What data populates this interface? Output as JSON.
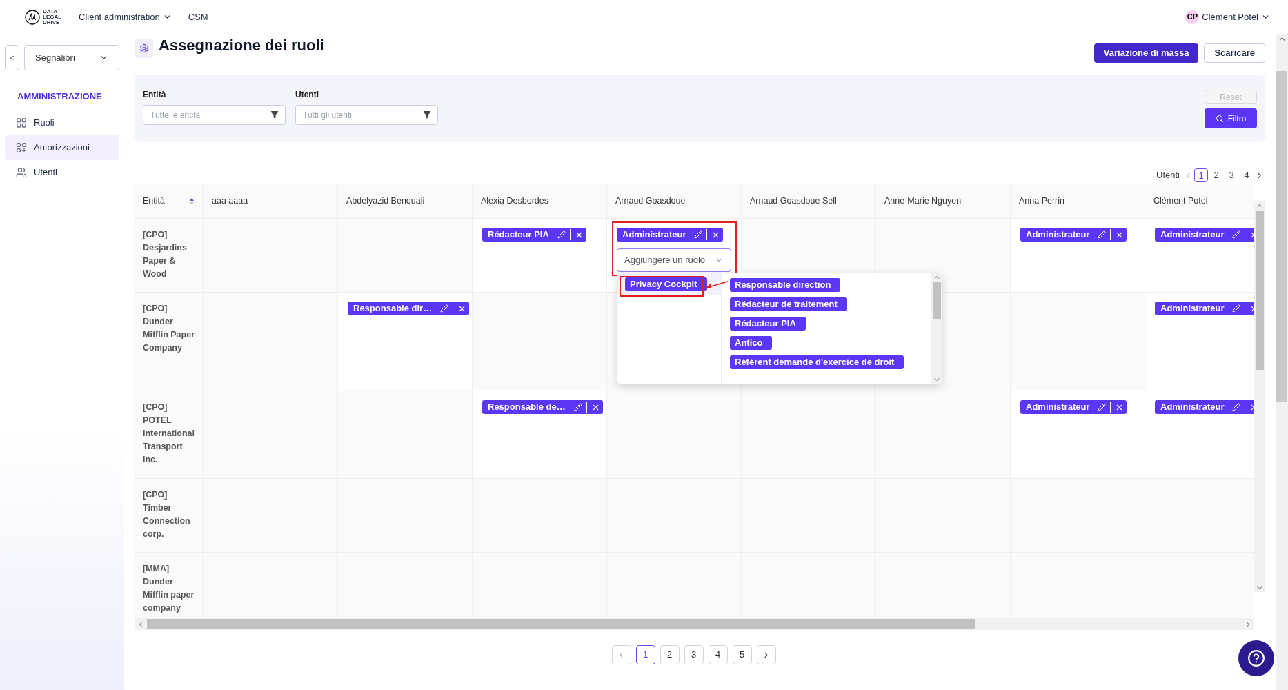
{
  "topbar": {
    "logo": "DATA LEGAL DRIVE",
    "nav": [
      {
        "label": "Client administration",
        "dropdown": true
      },
      {
        "label": "CSM",
        "dropdown": false
      }
    ],
    "user": {
      "initials": "CP",
      "name": "Clément Potel"
    }
  },
  "sidebar": {
    "back": "<",
    "bookmarks": "Segnalibri",
    "section": "AMMINISTRAZIONE",
    "items": [
      {
        "label": "Ruoli",
        "selected": false
      },
      {
        "label": "Autorizzazioni",
        "selected": true
      },
      {
        "label": "Utenti",
        "selected": false
      }
    ]
  },
  "page": {
    "title": "Assegnazione dei ruoli",
    "buttons": [
      {
        "label": "Variazione di massa",
        "kind": "primary"
      },
      {
        "label": "Scaricare",
        "kind": "outline"
      }
    ]
  },
  "filters": {
    "fields": [
      {
        "label": "Entità",
        "placeholder": "Tutte le entità"
      },
      {
        "label": "Utenti",
        "placeholder": "Tutti gli utenti"
      }
    ],
    "reset": {
      "label": "Reset",
      "disabled": true
    },
    "filter": {
      "label": "Filtro"
    }
  },
  "top_pagination": {
    "label": "Utenti",
    "pages": [
      {
        "label": "1",
        "selected": true
      },
      {
        "label": "2",
        "selected": false
      },
      {
        "label": "3",
        "selected": false
      },
      {
        "label": "4",
        "selected": false
      }
    ]
  },
  "table": {
    "columns": [
      "Entità",
      "aaa aaaa",
      "Abdelyazid Benouali",
      "Alexia Desbordes",
      "Arnaud Goasdoue",
      "Arnaud Goasdoue Sell",
      "Anne-Marie Nguyen",
      "Anna Perrin",
      "Clément Potel"
    ],
    "rows": [
      {
        "cells": [
          {
            "text": "[CPO] Desjardins Paper & Wood"
          },
          {},
          {},
          {
            "roles": [
              "Rédacteur PIA"
            ]
          },
          {
            "roles": [
              "Administrateur"
            ],
            "select": {
              "placeholder": "Aggiungere un ruolo"
            }
          },
          {},
          {},
          {
            "roles": [
              "Administrateur"
            ]
          },
          {
            "roles": [
              "Administrateur"
            ]
          }
        ]
      },
      {
        "cells": [
          {
            "text": "[CPO] Dunder Mifflin Paper Company"
          },
          {},
          {
            "roles": [
              "Responsable dir…"
            ]
          },
          {},
          {},
          {},
          {},
          {},
          {
            "roles": [
              "Administrateur"
            ]
          }
        ]
      },
      {
        "cells": [
          {
            "text": "[CPO] POTEL International Transport inc."
          },
          {},
          {},
          {
            "roles": [
              "Responsable de…"
            ]
          },
          {},
          {},
          {},
          {
            "roles": [
              "Administrateur"
            ]
          },
          {
            "roles": [
              "Administrateur"
            ]
          }
        ]
      },
      {
        "cells": [
          {
            "text": "[CPO] Timber Connection corp."
          },
          {},
          {},
          {},
          {},
          {},
          {},
          {},
          {}
        ]
      },
      {
        "cells": [
          {
            "text": "[MMA] Dunder Mifflin paper company"
          },
          {},
          {},
          {},
          {},
          {},
          {},
          {},
          {}
        ]
      }
    ]
  },
  "role_dropdown": {
    "columns": [
      {
        "options": [
          {
            "label": "Privacy Cockpit",
            "selected": true
          }
        ]
      },
      {
        "options": [
          {
            "label": "Responsable direction",
            "selected": false
          },
          {
            "label": "Rédacteur de traitement",
            "selected": false
          },
          {
            "label": "Rédacteur PIA",
            "selected": false
          },
          {
            "label": "Antico",
            "selected": false
          },
          {
            "label": "Référent demande d'exercice de droit",
            "selected": false
          }
        ]
      }
    ]
  },
  "bottom_pagination": {
    "pages": [
      {
        "label": "1",
        "selected": true
      },
      {
        "label": "2",
        "selected": false
      },
      {
        "label": "3",
        "selected": false
      },
      {
        "label": "4",
        "selected": false
      },
      {
        "label": "5",
        "selected": false
      }
    ]
  }
}
